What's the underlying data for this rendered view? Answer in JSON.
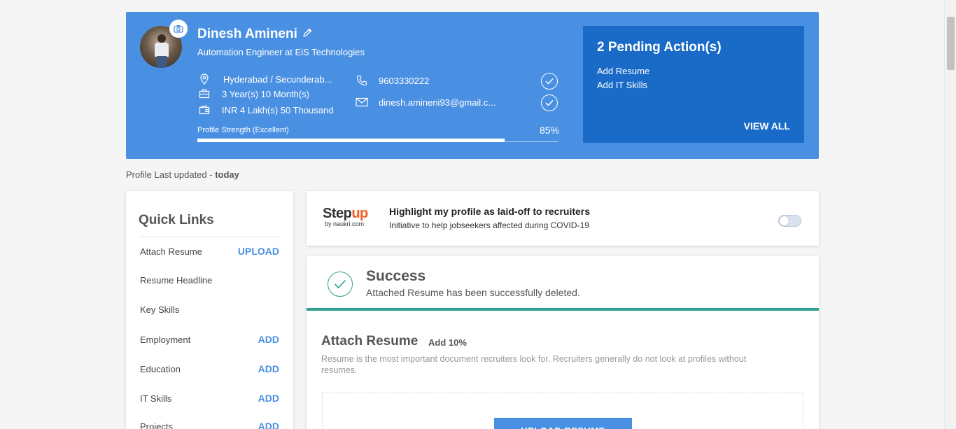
{
  "profile": {
    "name": "Dinesh Amineni",
    "designation": "Automation Engineer at EiS Technologies",
    "location": "Hyderabad / Secunderab...",
    "experience": "3 Year(s) 10 Month(s)",
    "salary": "INR 4 Lakh(s) 50 Thousand",
    "phone": "9603330222",
    "email": "dinesh.amineni93@gmail.c...",
    "strength_label": "Profile Strength (Excellent)",
    "strength_percent_text": "85%",
    "strength_value": 0.85
  },
  "pending": {
    "title": "2 Pending Action(s)",
    "items": [
      "Add Resume",
      "Add IT Skills"
    ],
    "view_all": "VIEW ALL"
  },
  "last_updated": {
    "prefix": "Profile Last updated - ",
    "value": "today"
  },
  "quick_links": {
    "title": "Quick Links",
    "items": [
      {
        "label": "Attach Resume",
        "action": "UPLOAD"
      },
      {
        "label": "Resume Headline",
        "action": ""
      },
      {
        "label": "Key Skills",
        "action": ""
      },
      {
        "label": "Employment",
        "action": "ADD"
      },
      {
        "label": "Education",
        "action": "ADD"
      },
      {
        "label": "IT Skills",
        "action": "ADD"
      },
      {
        "label": "Projects",
        "action": "ADD"
      }
    ]
  },
  "stepup": {
    "logo_part1": "Step",
    "logo_part2": "up",
    "logo_sub": "by naukri.com",
    "title": "Highlight my profile as laid-off to recruiters",
    "subtitle": "Initiative to help jobseekers affected during COVID-19",
    "toggle_on": false
  },
  "success": {
    "title": "Success",
    "message": "Attached Resume has been successfully deleted."
  },
  "attach": {
    "title": "Attach Resume",
    "add_label": "Add 10%",
    "description": "Resume is the most important document recruiters look for. Recruiters generally do not look at profiles without resumes.",
    "upload_button": "UPLOAD RESUME"
  },
  "colors": {
    "header_blue": "#4a90e2",
    "pending_blue": "#1a6bc7",
    "success_teal": "#2e9e8f",
    "brand_orange": "#f25c22"
  }
}
